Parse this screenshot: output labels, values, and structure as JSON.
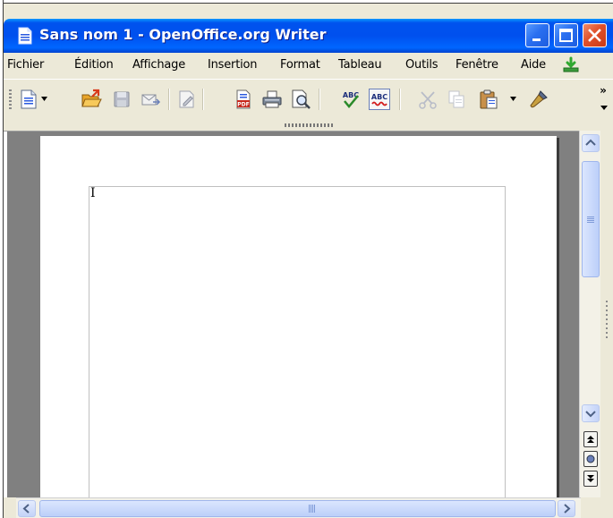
{
  "window": {
    "title": "Sans nom 1 - OpenOffice.org Writer"
  },
  "menu": {
    "items": [
      "Fichier",
      "Édition",
      "Affichage",
      "Insertion",
      "Format",
      "Tableau",
      "Outils",
      "Fenêtre",
      "Aide"
    ]
  },
  "toolbar": {
    "tools": [
      "new",
      "open",
      "save",
      "email",
      "edit-file",
      "export-pdf",
      "print",
      "page-preview",
      "spellcheck",
      "autospellcheck",
      "cut",
      "copy",
      "paste",
      "clone-formatting"
    ],
    "overflow": "»"
  },
  "document": {
    "cursor_glyph": "I"
  },
  "colors": {
    "titlebar": "#0054e3",
    "chrome": "#ece9d8",
    "doc_bg": "#808080",
    "page": "#ffffff"
  }
}
